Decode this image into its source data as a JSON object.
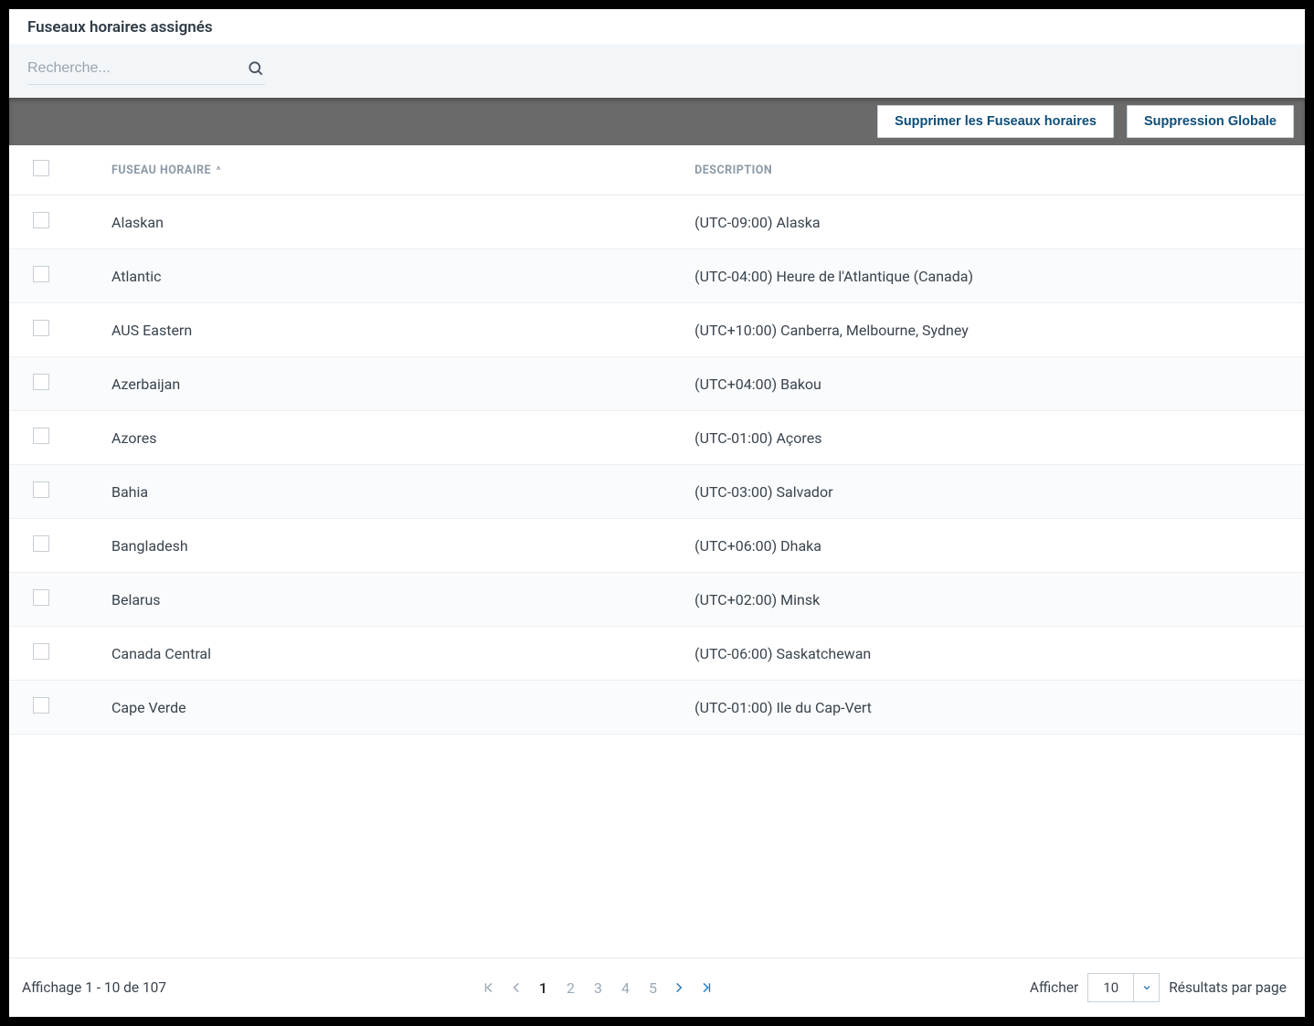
{
  "title": "Fuseaux horaires assignés",
  "search": {
    "placeholder": "Recherche..."
  },
  "toolbar": {
    "delete_timezones": "Supprimer les Fuseaux horaires",
    "global_delete": "Suppression Globale"
  },
  "columns": {
    "name": "FUSEAU HORAIRE",
    "description": "DESCRIPTION",
    "sort_indicator": "^"
  },
  "rows": [
    {
      "name": "Alaskan",
      "description": "(UTC-09:00) Alaska"
    },
    {
      "name": "Atlantic",
      "description": "(UTC-04:00) Heure de l'Atlantique (Canada)"
    },
    {
      "name": "AUS Eastern",
      "description": "(UTC+10:00) Canberra, Melbourne, Sydney"
    },
    {
      "name": "Azerbaijan",
      "description": "(UTC+04:00) Bakou"
    },
    {
      "name": "Azores",
      "description": "(UTC-01:00) Açores"
    },
    {
      "name": "Bahia",
      "description": "(UTC-03:00) Salvador"
    },
    {
      "name": "Bangladesh",
      "description": "(UTC+06:00) Dhaka"
    },
    {
      "name": "Belarus",
      "description": "(UTC+02:00) Minsk"
    },
    {
      "name": "Canada Central",
      "description": "(UTC-06:00) Saskatchewan"
    },
    {
      "name": "Cape Verde",
      "description": "(UTC-01:00) Ile du Cap-Vert"
    }
  ],
  "footer": {
    "showing": "Affichage 1 - 10 de 107",
    "pages": [
      "1",
      "2",
      "3",
      "4",
      "5"
    ],
    "current_page": "1",
    "afficher_label": "Afficher",
    "page_size": "10",
    "results_label": "Résultats par page"
  }
}
